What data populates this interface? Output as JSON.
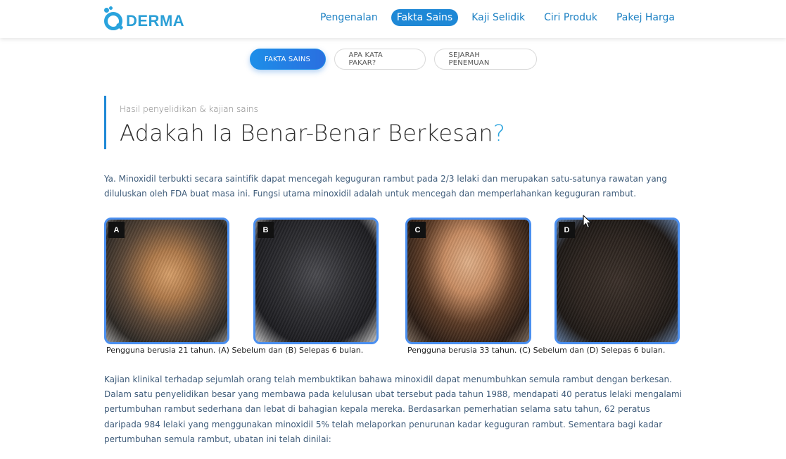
{
  "header": {
    "logo_text": "DERMA",
    "nav": [
      "Pengenalan",
      "Fakta Sains",
      "Kaji Selidik",
      "Ciri Produk",
      "Pakej Harga"
    ],
    "active_nav": "Fakta Sains"
  },
  "subtabs": [
    "FAKTA SAINS",
    "APA KATA PAKAR?",
    "SEJARAH PENEMUAN"
  ],
  "heading": {
    "kicker": "Hasil penyelidikan & kajian sains",
    "title": "Adakah Ia Benar-Benar Berkesan",
    "title_mark": "?"
  },
  "intro": "Ya. Minoxidil terbukti secara saintifik dapat mencegah keguguran rambut pada 2/3 lelaki dan merupakan satu-satunya rawatan yang diluluskan oleh FDA buat masa ini. Fungsi utama minoxidil adalah untuk mencegah dan memperlahankan keguguran rambut.",
  "photos": [
    {
      "letter": "A"
    },
    {
      "letter": "B"
    },
    {
      "letter": "C"
    },
    {
      "letter": "D"
    }
  ],
  "captions": [
    "Pengguna berusia 21 tahun. (A) Sebelum dan (B) Selepas 6 bulan.",
    "Pengguna berusia 33 tahun. (C) Sebelum dan (D) Selepas 6 bulan."
  ],
  "body": "Kajian klinikal terhadap sejumlah orang telah membuktikan bahawa minoxidil dapat menumbuhkan semula rambut dengan berkesan. Dalam satu penyelidikan besar yang membawa pada kelulusan ubat tersebut pada tahun 1988, mendapati 40 peratus lelaki mengalami pertumbuhan rambut sederhana dan lebat di bahagian kepala mereka. Berdasarkan pemerhatian selama satu tahun, 62 peratus daripada 984 lelaki yang menggunakan minoxidil 5% telah melaporkan penurunan kadar keguguran rambut. Sementara bagi kadar pertumbuhan semula rambut, ubatan ini telah dinilai:",
  "colors": {
    "accent": "#1e88d6",
    "logo": "#2b9fd6",
    "text": "#3f5c7a",
    "photo_border": "#4a8ff0"
  }
}
